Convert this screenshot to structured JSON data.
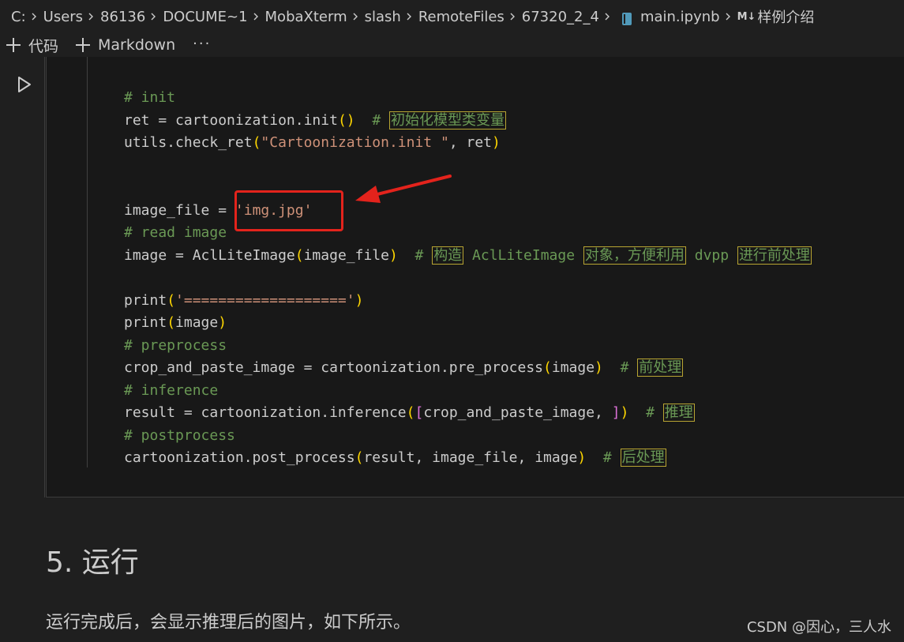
{
  "breadcrumb": {
    "items": [
      "C:",
      "Users",
      "86136",
      "DOCUME~1",
      "MobaXterm",
      "slash",
      "RemoteFiles",
      "67320_2_4",
      "main.ipynb",
      "样例介绍"
    ],
    "md_badge": "M↓"
  },
  "toolbar": {
    "code_label": "代码",
    "markdown_label": "Markdown",
    "more_label": "···"
  },
  "code": {
    "lines": [
      [
        {
          "t": "# init",
          "c": "comment"
        }
      ],
      [
        {
          "t": "ret = cartoonization.init"
        },
        {
          "t": "()",
          "c": "paren"
        },
        {
          "t": "  "
        },
        {
          "t": "# ",
          "c": "comment"
        },
        {
          "t": "初始化模型类变量",
          "c": "zh"
        }
      ],
      [
        {
          "t": "utils.check_ret"
        },
        {
          "t": "(",
          "c": "paren"
        },
        {
          "t": "\"Cartoonization.init \"",
          "c": "string"
        },
        {
          "t": ", ret"
        },
        {
          "t": ")",
          "c": "paren"
        }
      ],
      [],
      [],
      [
        {
          "t": "image_file = "
        },
        {
          "t": "'img.jpg'",
          "c": "string"
        }
      ],
      [
        {
          "t": "# read image",
          "c": "comment"
        }
      ],
      [
        {
          "t": "image = AclLiteImage"
        },
        {
          "t": "(",
          "c": "paren"
        },
        {
          "t": "image_file"
        },
        {
          "t": ")",
          "c": "paren"
        },
        {
          "t": "  "
        },
        {
          "t": "# ",
          "c": "comment"
        },
        {
          "t": "构造",
          "c": "zh"
        },
        {
          "t": " AclLiteImage ",
          "c": "comment"
        },
        {
          "t": "对象，方便利用",
          "c": "zh"
        },
        {
          "t": " dvpp ",
          "c": "comment"
        },
        {
          "t": "进行前处理",
          "c": "zh"
        }
      ],
      [],
      [
        {
          "t": "print"
        },
        {
          "t": "(",
          "c": "paren"
        },
        {
          "t": "'==================='",
          "c": "string"
        },
        {
          "t": ")",
          "c": "paren"
        }
      ],
      [
        {
          "t": "print"
        },
        {
          "t": "(",
          "c": "paren"
        },
        {
          "t": "image"
        },
        {
          "t": ")",
          "c": "paren"
        }
      ],
      [
        {
          "t": "# preprocess",
          "c": "comment"
        }
      ],
      [
        {
          "t": "crop_and_paste_image = cartoonization.pre_process"
        },
        {
          "t": "(",
          "c": "paren"
        },
        {
          "t": "image"
        },
        {
          "t": ")",
          "c": "paren"
        },
        {
          "t": "  "
        },
        {
          "t": "# ",
          "c": "comment"
        },
        {
          "t": "前处理",
          "c": "zh"
        }
      ],
      [
        {
          "t": "# inference",
          "c": "comment"
        }
      ],
      [
        {
          "t": "result = cartoonization.inference"
        },
        {
          "t": "(",
          "c": "paren"
        },
        {
          "t": "[",
          "c": "bracket"
        },
        {
          "t": "crop_and_paste_image, "
        },
        {
          "t": "]",
          "c": "bracket"
        },
        {
          "t": ")",
          "c": "paren"
        },
        {
          "t": "  "
        },
        {
          "t": "# ",
          "c": "comment"
        },
        {
          "t": "推理",
          "c": "zh"
        }
      ],
      [
        {
          "t": "# postprocess",
          "c": "comment"
        }
      ],
      [
        {
          "t": "cartoonization.post_process"
        },
        {
          "t": "(",
          "c": "paren"
        },
        {
          "t": "result, image_file, image"
        },
        {
          "t": ")",
          "c": "paren"
        },
        {
          "t": "  "
        },
        {
          "t": "# ",
          "c": "comment"
        },
        {
          "t": "后处理",
          "c": "zh"
        }
      ]
    ]
  },
  "markdown": {
    "heading": "5. 运行",
    "paragraph": "运行完成后，会显示推理后的图片，如下所示。"
  },
  "watermark": "CSDN @因心，三人水",
  "colors": {
    "background": "#1f1f1f",
    "cell_background": "#181818",
    "comment": "#6a9955",
    "string": "#ce9178",
    "paren": "#ffd700",
    "bracket": "#da70d6",
    "annotation": "#e3231c"
  }
}
